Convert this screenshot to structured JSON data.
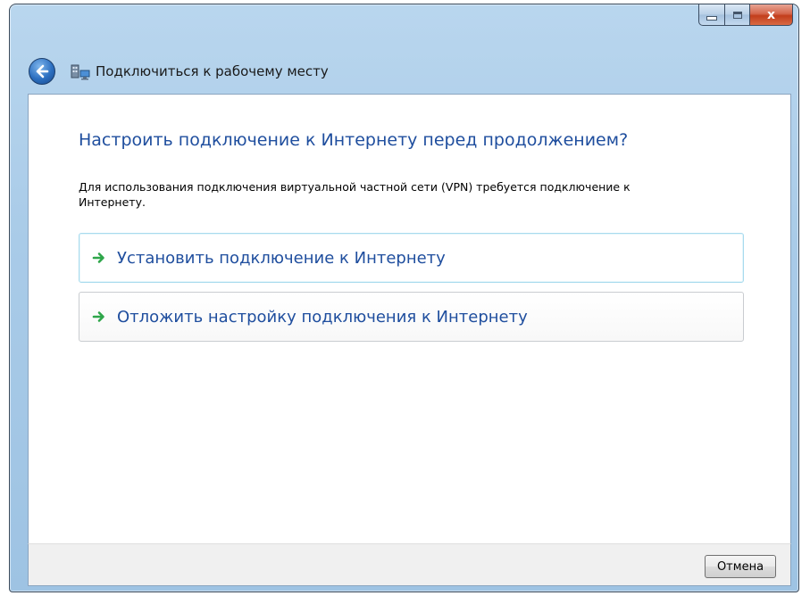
{
  "window": {
    "title": "Подключиться к рабочему месту",
    "icons": {
      "back": "back-arrow-icon",
      "app": "network-workplace-icon",
      "minimize": "minimize-icon",
      "maximize": "maximize-icon",
      "close": "close-icon"
    },
    "close_glyph": "x"
  },
  "main": {
    "heading": "Настроить подключение к Интернету перед продолжением?",
    "description": "Для использования подключения виртуальной частной сети (VPN) требуется подключение к Интернету.",
    "options": [
      {
        "label": "Установить подключение к Интернету",
        "icon": "green-arrow-icon"
      },
      {
        "label": "Отложить настройку подключения к Интернету",
        "icon": "green-arrow-icon"
      }
    ]
  },
  "footer": {
    "cancel_label": "Отмена"
  },
  "colors": {
    "accent_text": "#1f4e9e",
    "arrow_green": "#2ea64a",
    "close_red": "#c23d1c"
  }
}
